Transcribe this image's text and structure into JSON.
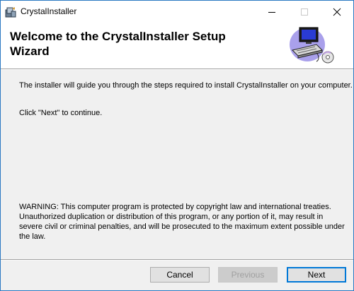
{
  "background_window": {
    "left_text": "... .. ..... ....... ....",
    "right_text": "....."
  },
  "window": {
    "title": "CrystalInstaller",
    "controls": {
      "minimize": "minimize",
      "maximize": "maximize",
      "close": "close"
    }
  },
  "banner": {
    "heading_line1": "Welcome to the CrystalInstaller Setup",
    "heading_line2": "Wizard"
  },
  "body": {
    "intro": "The installer will guide you through the steps required to install CrystalInstaller on your computer.",
    "instruction": "Click \"Next\" to continue.",
    "warning": "WARNING: This computer program is protected by copyright law and international treaties. Unauthorized duplication or distribution of this program, or any portion of it, may result in severe civil or criminal penalties, and will be prosecuted to the maximum extent possible under the law."
  },
  "buttons": {
    "cancel": "Cancel",
    "previous": "Previous",
    "next": "Next"
  },
  "colors": {
    "accent_border": "#0078d7",
    "window_border": "#2b79c2",
    "face": "#f0f0f0"
  }
}
